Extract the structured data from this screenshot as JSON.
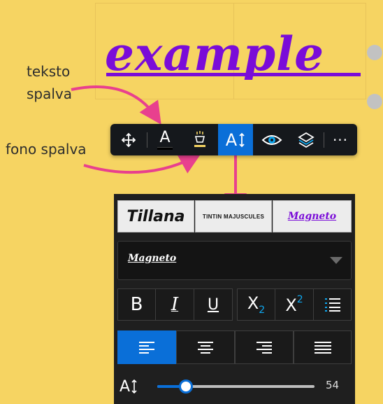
{
  "canvas": {
    "example_text": "example",
    "annotation_text_color": "teksto spalva",
    "annotation_bg_color": "fono spalva"
  },
  "toolbar": {
    "items": [
      {
        "name": "move",
        "icon": "move-icon"
      },
      {
        "name": "text-color",
        "icon": "text-color-icon",
        "label": "A"
      },
      {
        "name": "background-color",
        "icon": "highlighter-icon"
      },
      {
        "name": "font-size",
        "icon": "font-size-icon",
        "label": "A",
        "active": true
      },
      {
        "name": "visibility",
        "icon": "eye-icon"
      },
      {
        "name": "layers",
        "icon": "layers-icon"
      },
      {
        "name": "more",
        "icon": "more-icon",
        "label": "···"
      }
    ]
  },
  "panel": {
    "font_presets": [
      "Tillana",
      "Tintin Majuscules",
      "Magneto"
    ],
    "selected_font": "Magneto",
    "format_buttons": {
      "bold": "B",
      "italic": "I",
      "underline": "U",
      "subscript_base": "X",
      "subscript_mark": "2",
      "superscript_base": "X",
      "superscript_mark": "2"
    },
    "alignment": [
      "left",
      "center",
      "right",
      "justify"
    ],
    "active_alignment": "left",
    "size_label": "A",
    "size_value": "54",
    "size_fraction": 0.18
  },
  "colors": {
    "background": "#f6d462",
    "text_purple": "#7a0cd8",
    "accent_blue": "#0a6fd8",
    "arrow_pink": "#e8408e"
  }
}
